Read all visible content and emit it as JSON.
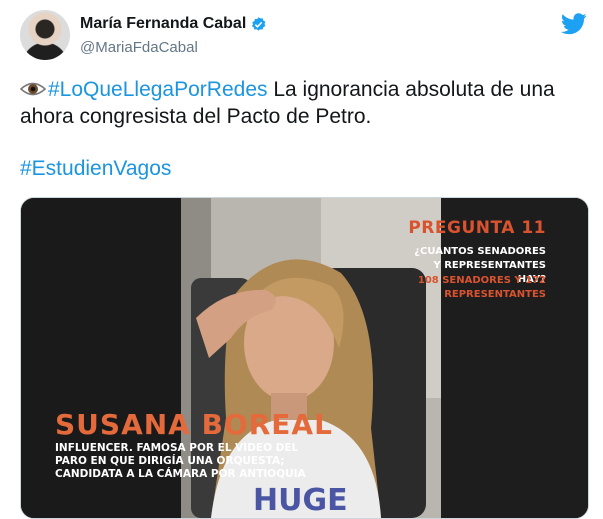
{
  "author": {
    "name": "María Fernanda Cabal",
    "handle": "@MariaFdaCabal"
  },
  "tweet": {
    "hashtag1": "#LoQueLlegaPorRedes",
    "body": " La ignorancia absoluta de una ahora congresista del Pacto de Petro.",
    "hashtag2": "#EstudienVagos"
  },
  "video": {
    "question_title": "PREGUNTA 11",
    "question_text": "¿CUANTOS SENADORES Y REPRESENTANTES HAY?",
    "answer_text": "108 SENADORES Y 172 REPRESENTANTES",
    "person_name": "SUSANA BOREAL",
    "person_description": "INFLUENCER. FAMOSA POR EL VIDEO DEL PARO EN QUE DIRIGÍA UNA ORQUESTA; CANDIDATA A LA CÁMARA POR ANTIOQUIA"
  },
  "colors": {
    "link": "#1b95e0",
    "twitter_blue": "#1da1f2",
    "overlay_orange": "#d9532f"
  },
  "icons": [
    "avatar",
    "verified-badge-icon",
    "twitter-bird-icon",
    "eye-icon"
  ]
}
